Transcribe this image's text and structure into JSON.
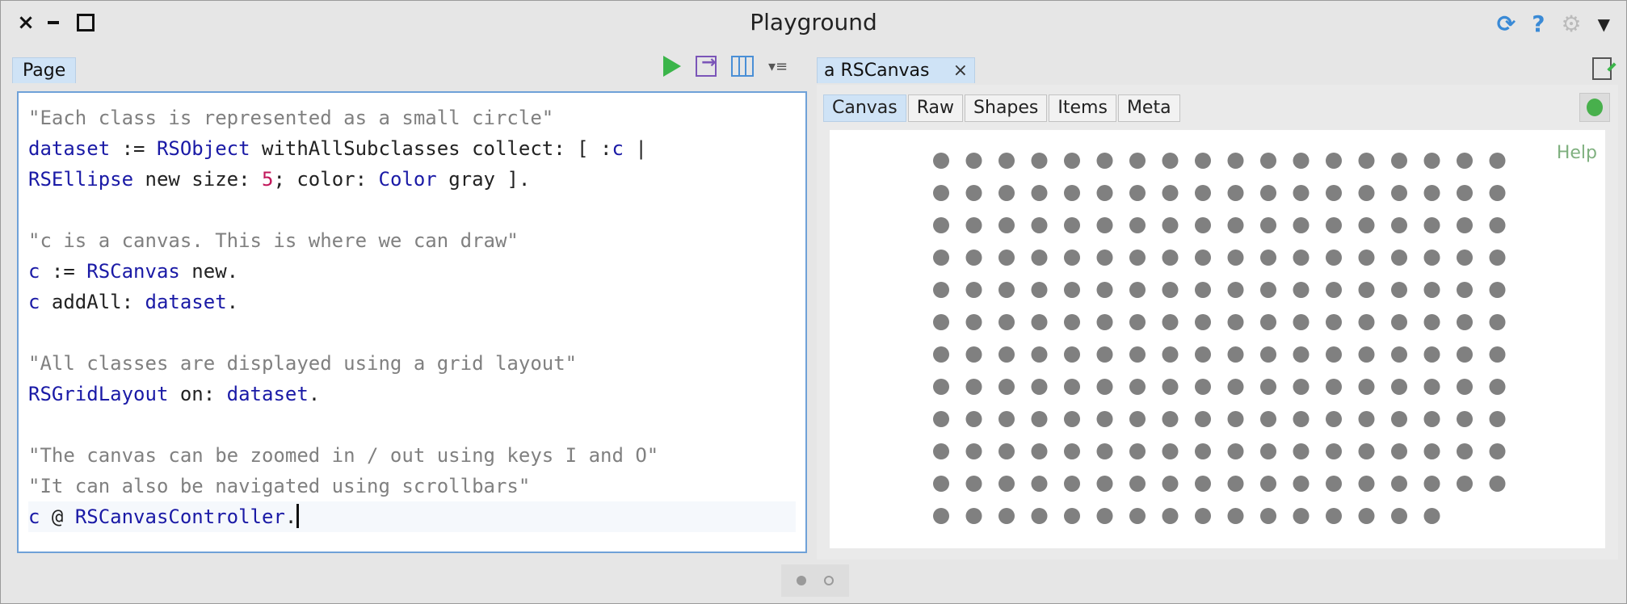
{
  "window": {
    "title": "Playground"
  },
  "left_pane": {
    "tab_label": "Page",
    "code_lines": [
      [
        {
          "t": "cmt",
          "s": "\"Each class is represented as a small circle\""
        }
      ],
      [
        {
          "t": "var",
          "s": "dataset"
        },
        {
          "t": "sel",
          "s": " := "
        },
        {
          "t": "kw",
          "s": "RSObject"
        },
        {
          "t": "sel",
          "s": " withAllSubclasses collect: [ :"
        },
        {
          "t": "var",
          "s": "c"
        },
        {
          "t": "sel",
          "s": " |"
        }
      ],
      [
        {
          "t": "kw",
          "s": "RSEllipse"
        },
        {
          "t": "sel",
          "s": " new size: "
        },
        {
          "t": "num",
          "s": "5"
        },
        {
          "t": "sel",
          "s": "; color: "
        },
        {
          "t": "kw",
          "s": "Color"
        },
        {
          "t": "sel",
          "s": " gray ]."
        }
      ],
      [],
      [
        {
          "t": "cmt",
          "s": "\"c is a canvas. This is where we can draw\""
        }
      ],
      [
        {
          "t": "var",
          "s": "c"
        },
        {
          "t": "sel",
          "s": " := "
        },
        {
          "t": "kw",
          "s": "RSCanvas"
        },
        {
          "t": "sel",
          "s": " new."
        }
      ],
      [
        {
          "t": "var",
          "s": "c"
        },
        {
          "t": "sel",
          "s": " addAll: "
        },
        {
          "t": "var",
          "s": "dataset"
        },
        {
          "t": "sel",
          "s": "."
        }
      ],
      [],
      [
        {
          "t": "cmt",
          "s": "\"All classes are displayed using a grid layout\""
        }
      ],
      [
        {
          "t": "kw",
          "s": "RSGridLayout"
        },
        {
          "t": "sel",
          "s": " on: "
        },
        {
          "t": "var",
          "s": "dataset"
        },
        {
          "t": "sel",
          "s": "."
        }
      ],
      [],
      [
        {
          "t": "cmt",
          "s": "\"The canvas can be zoomed in / out using keys I and O\""
        }
      ],
      [
        {
          "t": "cmt",
          "s": "\"It can also be navigated using scrollbars\""
        }
      ],
      [
        {
          "t": "var",
          "s": "c"
        },
        {
          "t": "sel",
          "s": " @ "
        },
        {
          "t": "kw",
          "s": "RSCanvasController"
        },
        {
          "t": "sel",
          "s": "."
        }
      ]
    ]
  },
  "right_pane": {
    "tab_label": "a RSCanvas",
    "subtabs": [
      "Canvas",
      "Raw",
      "Shapes",
      "Items",
      "Meta"
    ],
    "active_subtab": "Canvas",
    "help_label": "Help",
    "grid": {
      "columns": 18,
      "full_rows": 11,
      "last_row_count": 16,
      "dot_color": "#808080"
    }
  },
  "colors": {
    "accent": "#3a8ad6",
    "run": "#3bb54a",
    "tab_active": "#cfe3f6"
  },
  "icons": [
    "close-icon",
    "minimize-icon",
    "maximize-icon",
    "sync-icon",
    "help-icon",
    "gear-icon",
    "play-icon",
    "export-icon",
    "columns-icon",
    "menu-icon",
    "tab-close-icon",
    "edit-icon",
    "bug-icon"
  ]
}
